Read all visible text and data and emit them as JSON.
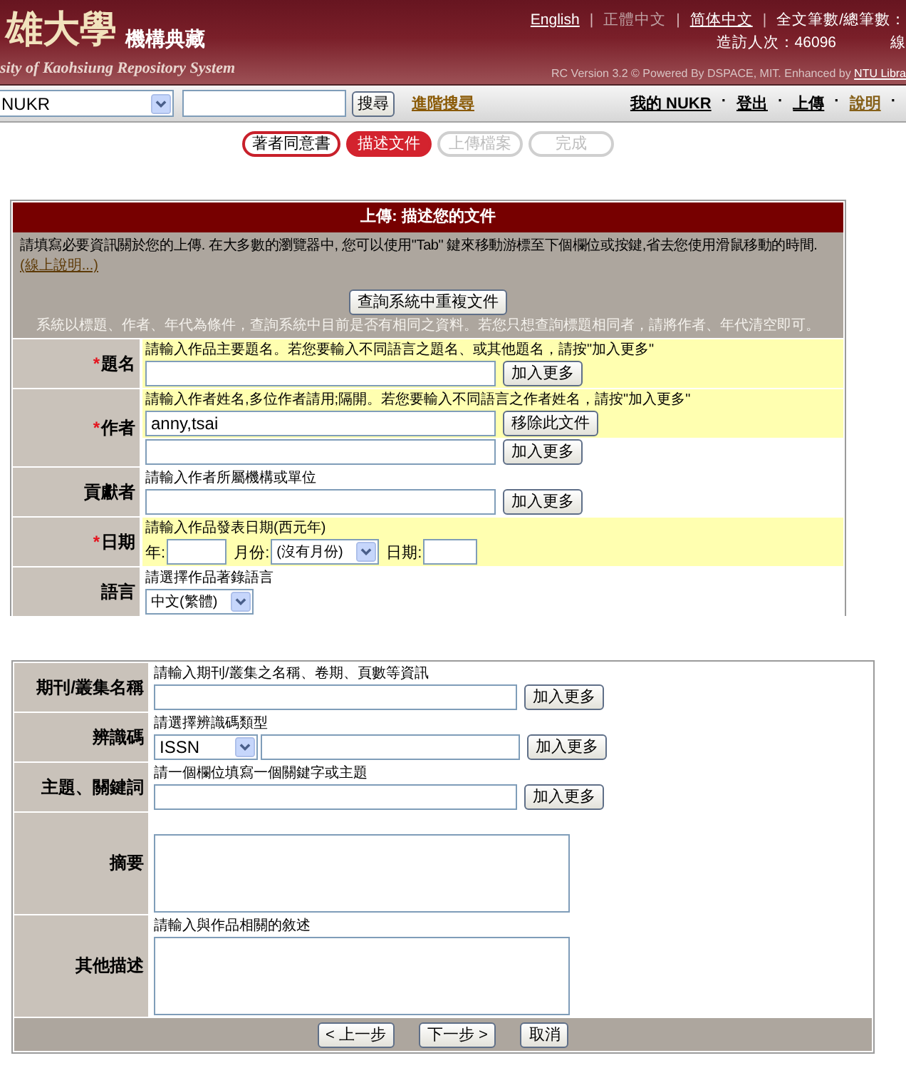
{
  "header": {
    "logo_title": "雄大學",
    "logo_subtitle": "機構典藏",
    "logo_tagline": "sity of Kaohsiung Repository System",
    "languages": [
      {
        "label": "English",
        "selected": false
      },
      {
        "label": "正體中文",
        "selected": true
      },
      {
        "label": "简体中文",
        "selected": false
      }
    ],
    "separator": "|",
    "stats_label": "全文筆數/總筆數：",
    "visitors": "造訪人次：46096",
    "online": "線",
    "version_text": "RC Version 3.2 © Powered By DSPACE, MIT. Enhanced by",
    "version_link": "NTU Libra"
  },
  "search_bar": {
    "scope": "NUKR",
    "search_button": "搜尋",
    "advanced_link": "進階搜尋",
    "nav_separator": "·",
    "nav_links": [
      {
        "label": "我的 NUKR",
        "visited": false
      },
      {
        "label": "登出",
        "visited": false
      },
      {
        "label": "上傳",
        "visited": false
      },
      {
        "label": "說明",
        "visited": true
      }
    ]
  },
  "steps": [
    {
      "label": "著者同意書",
      "completed": true,
      "selected": false
    },
    {
      "label": "描述文件",
      "completed": false,
      "selected": true
    },
    {
      "label": "上傳檔案",
      "completed": false,
      "selected": false
    },
    {
      "label": "完成",
      "completed": false,
      "selected": false
    }
  ],
  "form": {
    "title": "上傳: 描述您的文件",
    "intro": "請填寫必要資訊關於您的上傳. 在大多數的瀏覽器中, 您可以使用\"Tab\" 鍵來移動游標至下個欄位或按鍵,省去您使用滑鼠移動的時間.",
    "help_link": "(線上說明...)",
    "duplicate_button": "查詢系統中重複文件",
    "duplicate_hint": "系統以標題、作者、年代為條件，查詢系統中目前是否有相同之資料。若您只想查詢標題相同者，請將作者、年代清空即可。",
    "fields": [
      {
        "kind": "text",
        "label": "題名",
        "required_mark": "*",
        "hint": "請輸入作品主要題名。若您要輸入不同語言之題名、或其他題名，請按\"加入更多\"",
        "highlighted": true,
        "entries": [
          {
            "button": "加入更多",
            "highlighted": true
          }
        ]
      },
      {
        "kind": "text",
        "label": "作者",
        "required_mark": "*",
        "hint": "請輸入作者姓名,多位作者請用;隔開。若您要輸入不同語言之作者姓名，請按\"加入更多\"",
        "highlighted": true,
        "entries": [
          {
            "value": "anny,tsai",
            "button": "移除此文件",
            "highlighted": true
          },
          {
            "button": "加入更多",
            "highlighted": false
          }
        ]
      },
      {
        "kind": "text",
        "label": "貢獻者",
        "hint": "請輸入作者所屬機構或單位",
        "highlighted": false,
        "entries": [
          {
            "button": "加入更多",
            "highlighted": false
          }
        ]
      },
      {
        "kind": "date",
        "label": "日期",
        "required_mark": "*",
        "hint": "請輸入作品發表日期(西元年)",
        "highlighted": true,
        "year_label": "年:",
        "month_label": "月份:",
        "month_value": "(沒有月份)",
        "day_label": "日期:"
      },
      {
        "kind": "select",
        "label": "語言",
        "hint": "請選擇作品著錄語言",
        "highlighted": false,
        "value": "中文(繁體)"
      }
    ]
  },
  "form_continued": {
    "fields": [
      {
        "kind": "text",
        "label": "期刊/叢集名稱",
        "hint": "請輸入期刊/叢集之名稱、卷期、頁數等資訊",
        "highlighted": false,
        "entries": [
          {
            "button": "加入更多",
            "highlighted": false
          }
        ]
      },
      {
        "kind": "identifier",
        "label": "辨識碼",
        "hint": "請選擇辨識碼類型",
        "highlighted": false,
        "type_value": "ISSN",
        "button": "加入更多"
      },
      {
        "kind": "text",
        "label": "主題、關鍵詞",
        "hint": "請一個欄位填寫一個關鍵字或主題",
        "highlighted": false,
        "entries": [
          {
            "button": "加入更多",
            "highlighted": false
          }
        ]
      },
      {
        "kind": "textarea",
        "label": "摘要"
      },
      {
        "kind": "textarea",
        "label": "其他描述",
        "hint": "請輸入與作品相關的敘述",
        "highlighted": false
      }
    ],
    "buttons": [
      "< 上一步",
      "下一步 >",
      "取消"
    ]
  }
}
